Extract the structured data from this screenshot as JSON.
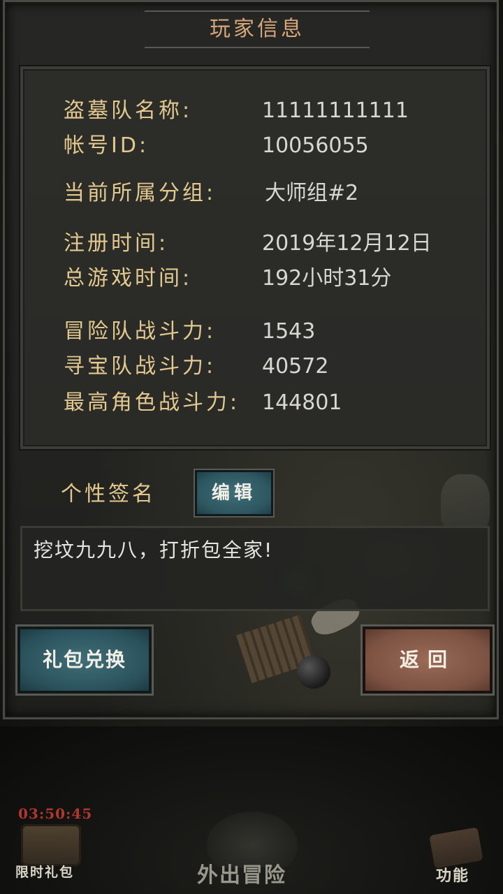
{
  "dialog": {
    "title": "玩家信息"
  },
  "info": [
    {
      "label": "盗墓队名称:",
      "value": "11111111111"
    },
    {
      "label": "帐号ID:",
      "value": "10056055"
    },
    {
      "label": "当前所属分组:",
      "value": "大师组#2"
    },
    {
      "label": "注册时间:",
      "value": "2019年12月12日"
    },
    {
      "label": "总游戏时间:",
      "value": "192小时31分"
    },
    {
      "label": "冒险队战斗力:",
      "value": "1543"
    },
    {
      "label": "寻宝队战斗力:",
      "value": "40572"
    },
    {
      "label": "最高角色战斗力:",
      "value": "144801"
    }
  ],
  "signature": {
    "label": "个性签名",
    "edit_button": "编辑",
    "text": "挖坟九九八，打折包全家!"
  },
  "buttons": {
    "gift_exchange": "礼包兑换",
    "back": "返回"
  },
  "bottom_nav": {
    "timer": "03:50:45",
    "limited_gift": "限时礼包",
    "adventure": "外出冒险",
    "functions": "功能"
  },
  "colors": {
    "title": "#d7a877",
    "label": "#e3c98f",
    "value": "#d8d8d0",
    "edit_button_bg": "#3f6e78",
    "back_button_bg": "#9a6a56",
    "timer": "#b1372e"
  },
  "icons": {
    "limited_gift": "treasure-chest-icon",
    "adventure": "adventure-icon",
    "functions": "function-icon"
  }
}
